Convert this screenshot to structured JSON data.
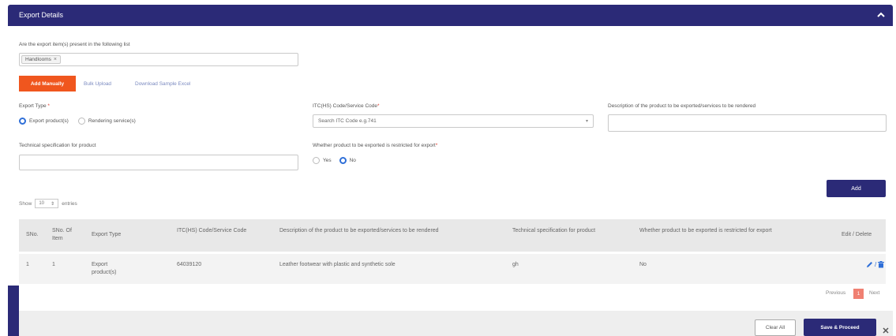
{
  "panel": {
    "title": "Export Details"
  },
  "question": "Are the export item(s) present in the following list",
  "selected_tag": "Handlooms",
  "tabs": {
    "add_manually": "Add Manually",
    "bulk_upload": "Bulk Upload",
    "download_sample": "Download Sample Excel"
  },
  "form": {
    "export_type_label": "Export Type",
    "export_type_required": "*",
    "export_type_options": [
      "Export product(s)",
      "Rendering service(s)"
    ],
    "itc_label": "ITC(HS) Code/Service Code",
    "itc_required": "*",
    "itc_placeholder": "Search ITC Code e.g.741",
    "description_label": "Description of the product to be exported/services to be rendered",
    "tech_spec_label": "Technical specification for product",
    "restricted_label": "Whether product to be exported is restricted for export",
    "restricted_required": "*",
    "restricted_options": [
      "Yes",
      "No"
    ]
  },
  "add_button": "Add",
  "entries": {
    "show": "Show",
    "value": "10",
    "suffix": "entries"
  },
  "table": {
    "headers": {
      "sno": "SNo.",
      "sno_item": "SNo. Of Item",
      "export_type": "Export Type",
      "itc": "ITC(HS) Code/Service Code",
      "description": "Description of the product to be exported/services to be rendered",
      "tech_spec": "Technical specification for product",
      "restricted": "Whether product to be exported is restricted for export",
      "edit_delete": "Edit / Delete"
    },
    "rows": [
      {
        "sno": "1",
        "sno_item": "1",
        "export_type": "Export product(s)",
        "itc": "64039120",
        "description": "Leather footwear with plastic and synthetic sole",
        "tech_spec": "gh",
        "restricted": "No"
      }
    ]
  },
  "pagination": {
    "previous": "Previous",
    "current": "1",
    "next": "Next"
  },
  "footer": {
    "clear_all": "Clear All",
    "save_proceed": "Save & Proceed"
  },
  "colors": {
    "header": "#2b2a77",
    "accent": "#f0561e",
    "radio": "#2f6fd8"
  }
}
